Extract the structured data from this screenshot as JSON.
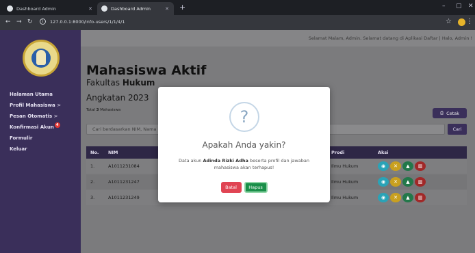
{
  "browser": {
    "tabs": [
      {
        "title": "Dashboard Admin"
      },
      {
        "title": "Dashboard Admin"
      }
    ],
    "url": "127.0.0.1:8000/info-users/1/1/4/1"
  },
  "sidebar": {
    "items": [
      {
        "label": "Halaman Utama"
      },
      {
        "label": "Profil Mahasiswa",
        "suffix": ">"
      },
      {
        "label": "Pesan Otomatis",
        "suffix": ">"
      },
      {
        "label": "Konfirmasi Akun",
        "badge": "4"
      },
      {
        "label": "Formulir"
      },
      {
        "label": "Keluar"
      }
    ]
  },
  "header": {
    "greeting": "Selamat Malam, Admin. Selamat datang di Aplikasi Daftar | Halo, Admin !"
  },
  "page": {
    "title": "Mahasiswa Aktif",
    "fakultas_prefix": "Fakultas",
    "fakultas_name": "Hukum",
    "angkatan": "Angkatan 2023",
    "total_prefix": "Total",
    "total_count": "3",
    "total_suffix": "Mahasiswa",
    "cetak_label": "Cetak",
    "search_placeholder": "Cari berdasarkan NIM, Nama",
    "cari_label": "Cari"
  },
  "table": {
    "headers": {
      "no": "No.",
      "nim": "NIM",
      "prodi": "Prodi",
      "aksi": "Aksi"
    },
    "rows": [
      {
        "no": "1.",
        "nim": "A1011231084",
        "prodi": "Ilmu Hukum"
      },
      {
        "no": "2.",
        "nim": "A1011231247",
        "prodi": "Ilmu Hukum"
      },
      {
        "no": "3.",
        "nim": "A1011231249",
        "prodi": "Ilmu Hukum"
      }
    ]
  },
  "modal": {
    "icon": "?",
    "title": "Apakah Anda yakin?",
    "text_prefix": "Data akun",
    "name": "Adinda Rizki Adha",
    "text_suffix": "beserta profil dan jawaban mahasiswa akan terhapus!",
    "cancel_label": "Batal",
    "confirm_label": "Hapus"
  },
  "colors": {
    "sidebar": "#3a2f5a",
    "danger": "#e04453",
    "success": "#1a8f49"
  }
}
